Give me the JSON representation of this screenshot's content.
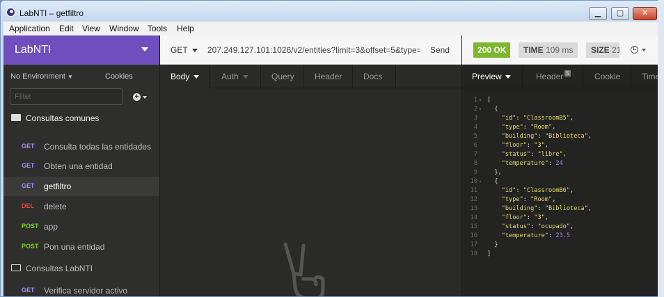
{
  "window": {
    "title": "LabNTI – getfiltro",
    "min_label": "▁",
    "max_label": "▢",
    "close_label": "✕"
  },
  "menu": [
    "Application",
    "Edit",
    "View",
    "Window",
    "Tools",
    "Help"
  ],
  "sidebar": {
    "workspace": "LabNTI",
    "environment": "No Environment",
    "cookies": "Cookies",
    "filter_placeholder": "Filter",
    "folders": [
      {
        "label": "Consultas comunes",
        "open": true
      },
      {
        "label": "Consultas LabNTI",
        "open": false
      }
    ],
    "requests": [
      {
        "method": "GET",
        "label": "Consulta todas las entidades",
        "color": "#a78bfa"
      },
      {
        "method": "GET",
        "label": "Obten una entidad",
        "color": "#a78bfa"
      },
      {
        "method": "GET",
        "label": "getfiltro",
        "color": "#a78bfa",
        "active": true
      },
      {
        "method": "DEL",
        "label": "delete",
        "color": "#e04a3a"
      },
      {
        "method": "POST",
        "label": "app",
        "color": "#7bd321"
      },
      {
        "method": "POST",
        "label": "Pon una entidad",
        "color": "#7bd321"
      },
      {
        "method": "GET",
        "label": "Verifica servidor activo",
        "color": "#a78bfa"
      }
    ]
  },
  "request": {
    "method": "GET",
    "url": "207.249.127.101:1026/v2/entities?limit=3&offset=5&type=",
    "send": "Send",
    "tabs": [
      "Body",
      "Auth",
      "Query",
      "Header",
      "Docs"
    ]
  },
  "response": {
    "status": "200 OK",
    "time_label": "TIME",
    "time_value": "109 ms",
    "size_label": "SIZE",
    "size_value": "21",
    "tabs": [
      "Preview",
      "Header",
      "Cookie",
      "Timel"
    ],
    "header_count": "5",
    "lines": [
      {
        "n": "1",
        "fold": "▾",
        "text": "["
      },
      {
        "n": "2",
        "fold": "▾",
        "text": "  {"
      },
      {
        "n": "3",
        "fold": "",
        "key": "\"id\"",
        "val": "\"ClassroomB5\"",
        "type": "s"
      },
      {
        "n": "4",
        "fold": "",
        "key": "\"type\"",
        "val": "\"Room\"",
        "type": "s"
      },
      {
        "n": "5",
        "fold": "",
        "key": "\"building\"",
        "val": "\"Biblioteca\"",
        "type": "s"
      },
      {
        "n": "6",
        "fold": "",
        "key": "\"floor\"",
        "val": "\"3\"",
        "type": "s"
      },
      {
        "n": "7",
        "fold": "",
        "key": "\"status\"",
        "val": "\"libre\"",
        "type": "s"
      },
      {
        "n": "8",
        "fold": "",
        "key": "\"temperature\"",
        "val": "24",
        "type": "n",
        "last": true
      },
      {
        "n": "9",
        "fold": "",
        "text": "  },"
      },
      {
        "n": "10",
        "fold": "▾",
        "text": "  {"
      },
      {
        "n": "11",
        "fold": "",
        "key": "\"id\"",
        "val": "\"ClassroomB6\"",
        "type": "s"
      },
      {
        "n": "12",
        "fold": "",
        "key": "\"type\"",
        "val": "\"Room\"",
        "type": "s"
      },
      {
        "n": "13",
        "fold": "",
        "key": "\"building\"",
        "val": "\"Biblioteca\"",
        "type": "s"
      },
      {
        "n": "14",
        "fold": "",
        "key": "\"floor\"",
        "val": "\"3\"",
        "type": "s"
      },
      {
        "n": "15",
        "fold": "",
        "key": "\"status\"",
        "val": "\"ocupado\"",
        "type": "s"
      },
      {
        "n": "16",
        "fold": "",
        "key": "\"temperature\"",
        "val": "23.5",
        "type": "n",
        "last": true
      },
      {
        "n": "17",
        "fold": "",
        "text": "  }"
      },
      {
        "n": "18",
        "fold": "",
        "text": "]"
      }
    ]
  }
}
